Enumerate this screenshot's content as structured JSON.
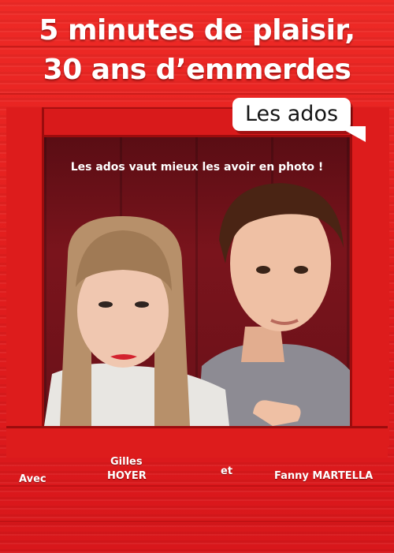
{
  "title": {
    "line1": "5 minutes de plaisir,",
    "line2": "30 ans d’emmerdes"
  },
  "bubble": {
    "text": "Les ados"
  },
  "tagline": "Les ados vaut mieux les avoir en photo !",
  "credits": {
    "avec": "Avec",
    "actor1_first": "Gilles",
    "actor1_last": "HOYER",
    "et": "et",
    "actor2": "Fanny MARTELLA"
  },
  "colors": {
    "background": "#e41b1b",
    "window": "#6a1119",
    "text": "#ffffff"
  }
}
